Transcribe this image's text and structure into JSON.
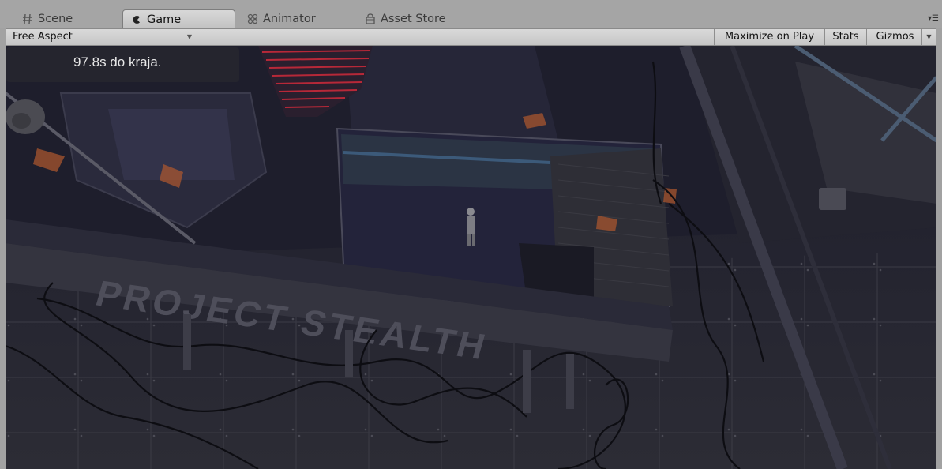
{
  "tabs": [
    {
      "label": "Scene",
      "icon": "hash-icon",
      "active": false
    },
    {
      "label": "Game",
      "icon": "game-icon",
      "active": true
    },
    {
      "label": "Animator",
      "icon": "animator-icon",
      "active": false
    },
    {
      "label": "Asset Store",
      "icon": "store-icon",
      "active": false
    }
  ],
  "toolbar": {
    "aspect_label": "Free Aspect",
    "maximize_label": "Maximize on Play",
    "stats_label": "Stats",
    "gizmos_label": "Gizmos"
  },
  "game": {
    "hud_timer": "97.8s do kraja.",
    "floor_text": "PROJECT STEALTH"
  },
  "colors": {
    "tab_bar": "#a5a5a5",
    "toolbar": "#d0d0d0",
    "viewport_dark": "#1d1d2a",
    "laser_red": "#d02a3a"
  }
}
